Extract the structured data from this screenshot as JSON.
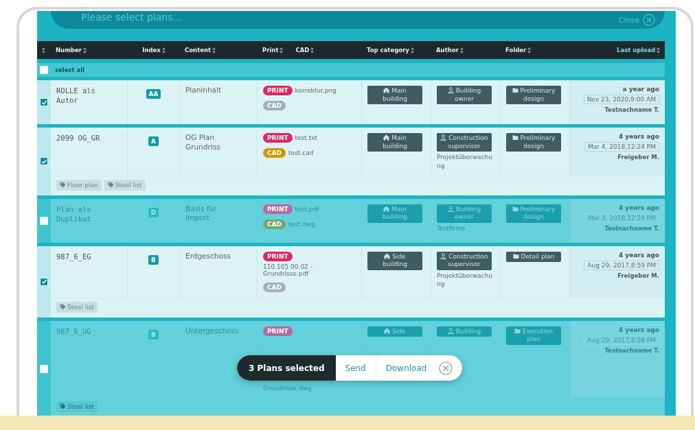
{
  "header": {
    "title": "Please select plans...",
    "close_label": "Close"
  },
  "table": {
    "columns": [
      {
        "kind": "icon"
      },
      {
        "kind": "plain",
        "label": "Number"
      },
      {
        "kind": "plain",
        "label": "Index"
      },
      {
        "kind": "plain",
        "label": "Content"
      },
      {
        "kind": "pair",
        "labels": [
          "Print",
          "CAD"
        ]
      },
      {
        "kind": "plain",
        "label": "Top category"
      },
      {
        "kind": "plain",
        "label": "Author"
      },
      {
        "kind": "plain",
        "label": "Folder"
      },
      {
        "kind": "sorted",
        "label": "Last upload"
      }
    ],
    "select_all": {
      "label": "select all",
      "checked": false
    },
    "rows": [
      {
        "selected": true,
        "number": "ROLLE als Autor",
        "index": "AA",
        "content": "Planinhalt",
        "files": [
          {
            "kind": "print",
            "text": "PRINT"
          },
          {
            "kind": "file",
            "text": "korrektur.png"
          },
          {
            "kind": "cad-empty",
            "text": "CAD"
          }
        ],
        "top_category": "Main building",
        "author": {
          "role": "Building owner"
        },
        "folder": "Preliminary design",
        "ago": "a year ago",
        "date": "Nov 23, 2020,9:00 AM",
        "uploader": "Testnachname T."
      },
      {
        "selected": true,
        "number": "2099 OG_GR",
        "index": "A",
        "content": "OG Plan Grundriss",
        "files": [
          {
            "kind": "print",
            "text": "PRINT"
          },
          {
            "kind": "file",
            "text": "test.txt"
          },
          {
            "kind": "cad",
            "text": "CAD"
          },
          {
            "kind": "file",
            "text": "test.cad"
          }
        ],
        "top_category": "Main building",
        "author": {
          "role": "Construction supervisor",
          "company": "Projektüberwachung"
        },
        "folder": "Preliminary design",
        "ago": "4 years ago",
        "date": "Mar 4, 2018,12:24 PM",
        "uploader": "Freigeber M.",
        "tags": [
          "Floor plan",
          "Steel list"
        ]
      },
      {
        "selected": false,
        "number": "Plan als Duplikat",
        "index": "D",
        "content": "Basis für Import",
        "files": [
          {
            "kind": "print",
            "text": "PRINT"
          },
          {
            "kind": "file",
            "text": "test.pdf"
          },
          {
            "kind": "cad",
            "text": "CAD"
          },
          {
            "kind": "file",
            "text": "test.dwg"
          }
        ],
        "top_category": "Main building",
        "author": {
          "role": "Building owner",
          "company": "Testfirma"
        },
        "folder": "Preliminary design",
        "ago": "4 years ago",
        "date": "Mar 3, 2018,12:24 PM",
        "uploader": "Testnachname T."
      },
      {
        "selected": true,
        "number": "987_6_EG",
        "index": "B",
        "content": "Erdgeschoss",
        "files": [
          {
            "kind": "print",
            "text": "PRINT"
          },
          {
            "kind": "file",
            "text": "110.105 00.02 - Grundrisse.pdf"
          },
          {
            "kind": "cad-empty",
            "text": "CAD"
          }
        ],
        "top_category": "Side building",
        "author": {
          "role": "Construction supervisor",
          "company": "Projektüberwachung"
        },
        "folder": "Detail plan",
        "ago": "4 years ago",
        "date": "Aug 29, 2017,8:59 PM",
        "uploader": "Freigeber M.",
        "tags": [
          "Steel list"
        ]
      },
      {
        "selected": false,
        "number": "987_6_UG",
        "index": "B",
        "content": "Untergeschoss",
        "files": [
          {
            "kind": "print",
            "text": "PRINT"
          },
          {
            "kind": "file-below",
            "text": "Grundrisse.dwg"
          }
        ],
        "top_category": "Side",
        "author": {
          "role": "Building"
        },
        "folder": "Execution plan",
        "ago": "4 years ago",
        "date": "Aug 29, 2017,8:58 PM",
        "uploader": "Testnachname T.",
        "tags": [
          "Steel list"
        ]
      }
    ]
  },
  "selection_bar": {
    "label": "3 Plans selected",
    "actions": [
      "Send",
      "Download"
    ]
  }
}
